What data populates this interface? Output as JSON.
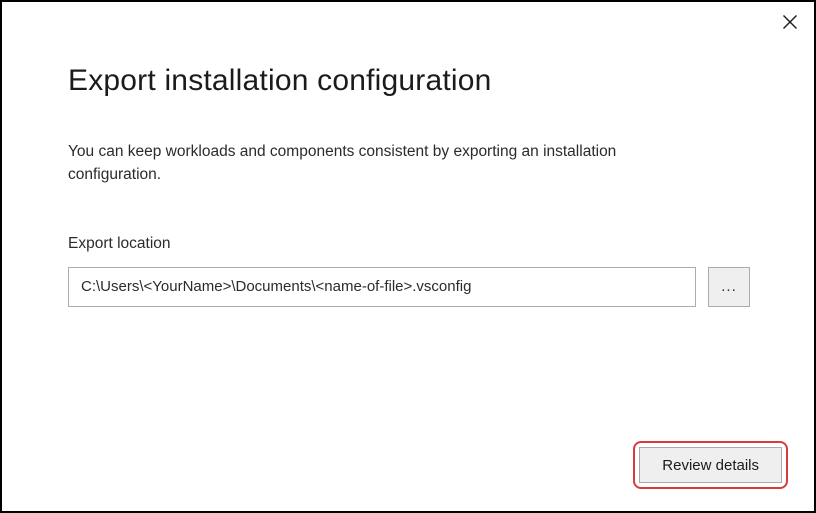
{
  "dialog": {
    "title": "Export installation configuration",
    "description": "You can keep workloads and components consistent by exporting an installation configuration.",
    "export_location_label": "Export location",
    "export_location_value": "C:\\Users\\<YourName>\\Documents\\<name-of-file>.vsconfig",
    "browse_button_label": "...",
    "review_button_label": "Review details"
  }
}
